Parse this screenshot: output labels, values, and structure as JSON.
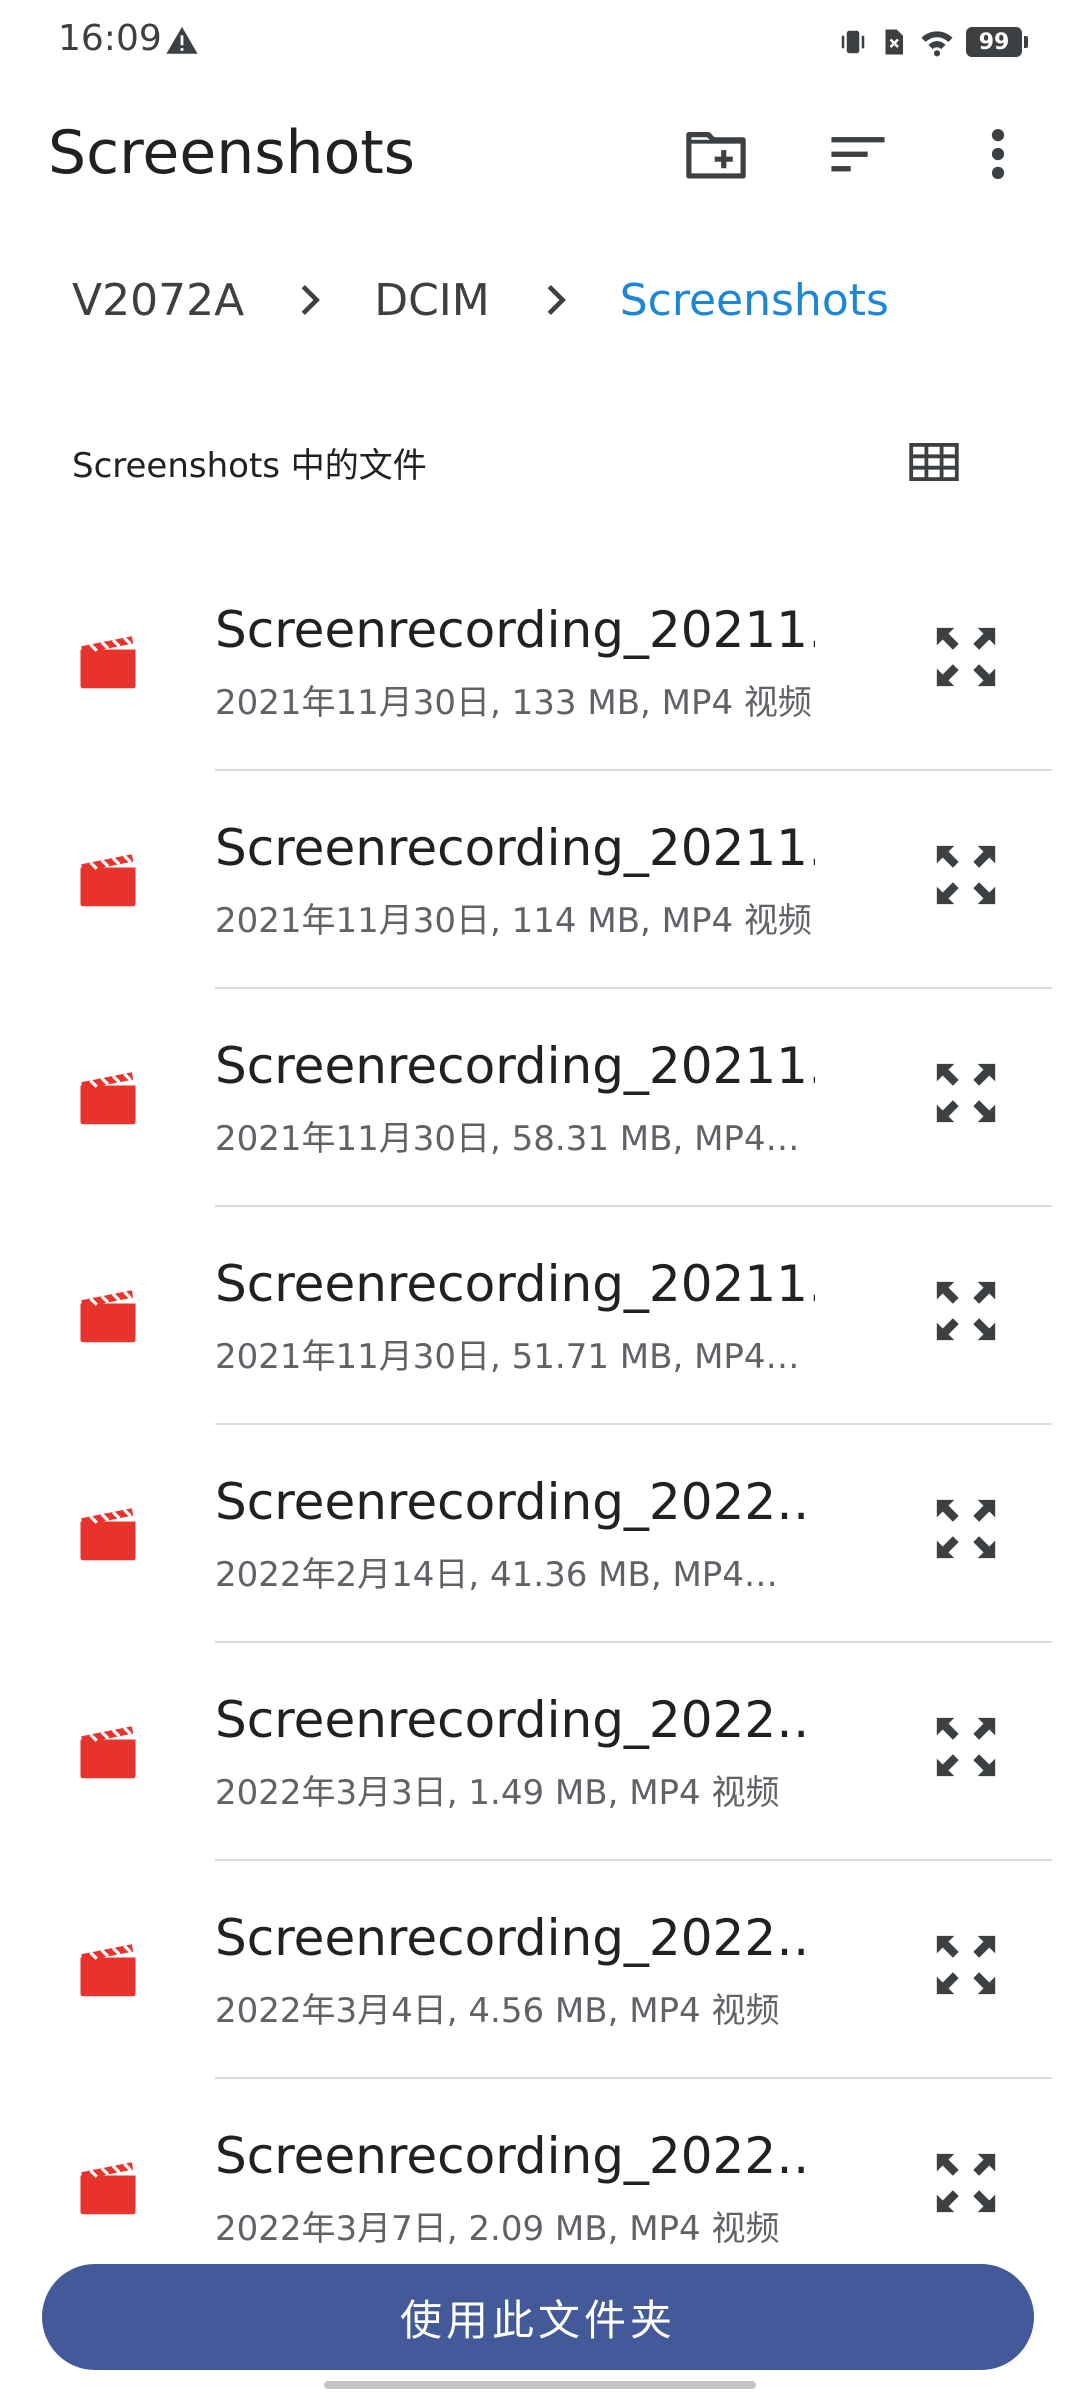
{
  "status_bar": {
    "time": "16:09",
    "battery": "99",
    "icons": [
      "alert-icon",
      "vibrate-icon",
      "no-sim-icon",
      "wifi-icon",
      "battery-icon"
    ]
  },
  "app_bar": {
    "title": "Screenshots",
    "icons": [
      "new-folder-icon",
      "sort-icon",
      "more-vert-icon"
    ]
  },
  "breadcrumb": {
    "items": [
      "V2072A",
      "DCIM",
      "Screenshots"
    ]
  },
  "section": {
    "title": "Screenshots 中的文件",
    "view_toggle_icon": "grid-view-icon"
  },
  "files": [
    {
      "name": "Screenrecording_20211…",
      "meta": "2021年11月30日, 133 MB, MP4 视频"
    },
    {
      "name": "Screenrecording_20211…",
      "meta": "2021年11月30日, 114 MB, MP4 视频"
    },
    {
      "name": "Screenrecording_20211…",
      "meta": "2021年11月30日, 58.31 MB, MP4…"
    },
    {
      "name": "Screenrecording_20211…",
      "meta": "2021年11月30日, 51.71 MB, MP4…"
    },
    {
      "name": "Screenrecording_2022…",
      "meta": "2022年2月14日, 41.36 MB, MP4…"
    },
    {
      "name": "Screenrecording_2022…",
      "meta": "2022年3月3日, 1.49 MB, MP4 视频"
    },
    {
      "name": "Screenrecording_2022…",
      "meta": "2022年3月4日, 4.56 MB, MP4 视频"
    },
    {
      "name": "Screenrecording_2022…",
      "meta": "2022年3月7日, 2.09 MB, MP4 视频"
    }
  ],
  "actions": {
    "use_folder": "使用此文件夹"
  },
  "colors": {
    "accent": "#1b87d6",
    "button": "#44599a",
    "video_icon": "#e8322c"
  }
}
